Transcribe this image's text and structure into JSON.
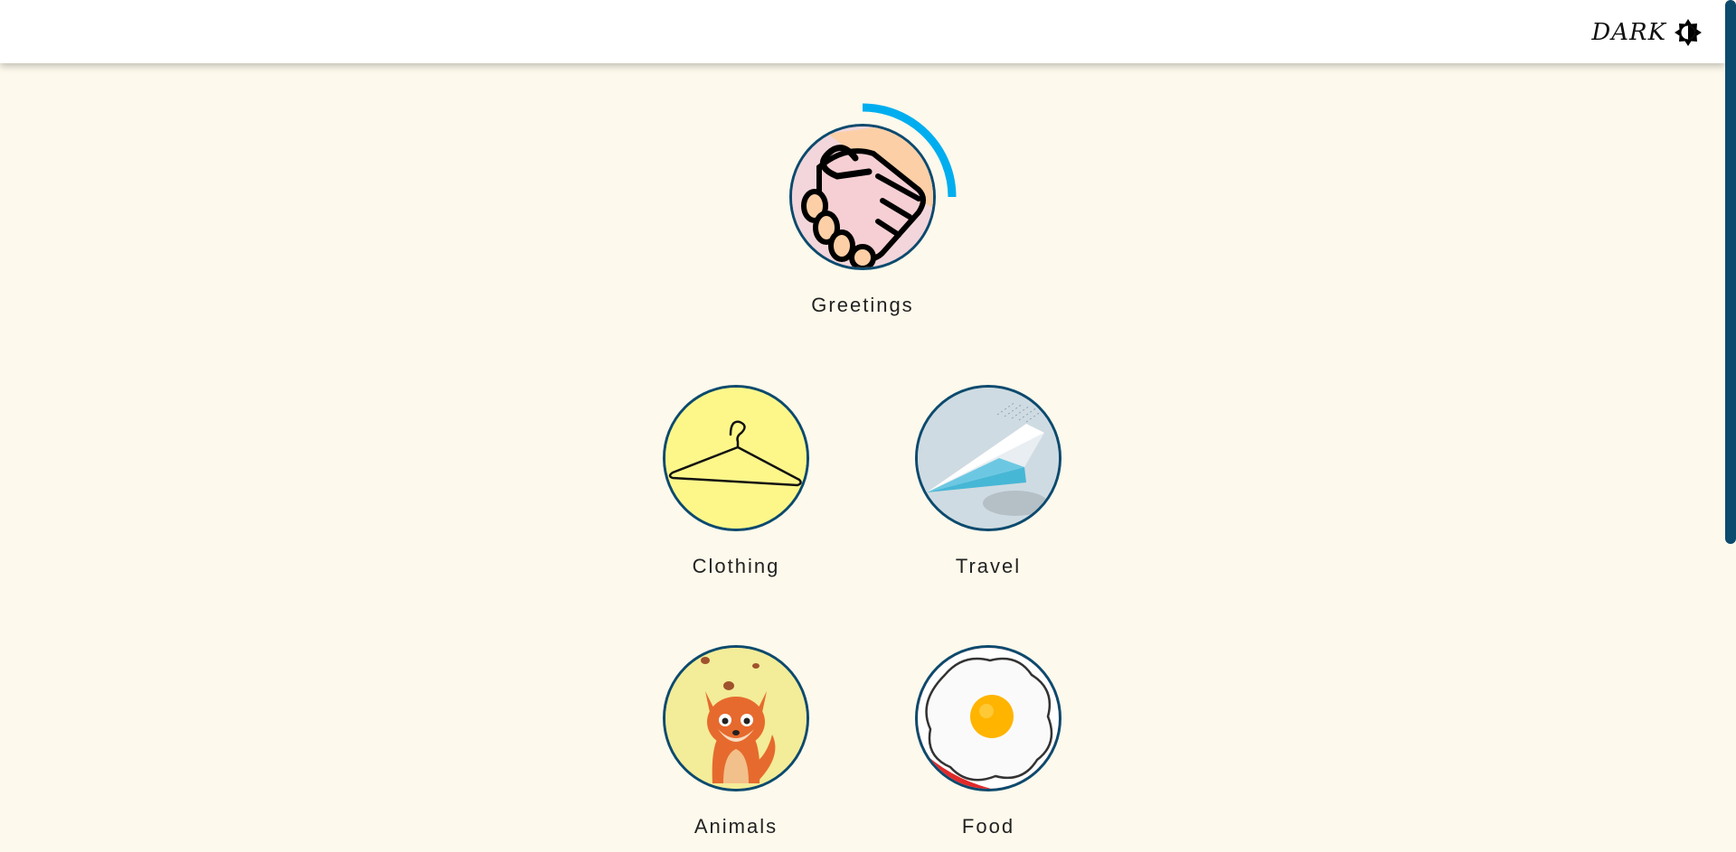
{
  "header": {
    "theme_label": "DARK",
    "theme_icon": "brightness-contrast-icon"
  },
  "units": [
    {
      "label": "Greetings",
      "icon": "handshake-icon",
      "progress": 0.25,
      "colors": {
        "bg": "#f2d6db"
      }
    },
    {
      "label": "Clothing",
      "icon": "hanger-icon",
      "colors": {
        "bg": "#fdf78a"
      }
    },
    {
      "label": "Travel",
      "icon": "paper-plane-icon",
      "colors": {
        "bg": "#cfdbe2"
      }
    },
    {
      "label": "Animals",
      "icon": "fox-icon",
      "colors": {
        "bg": "#f3ec98"
      }
    },
    {
      "label": "Food",
      "icon": "fried-egg-icon",
      "colors": {
        "bg": "#e02a2a"
      }
    }
  ],
  "colors": {
    "page_bg": "#fdf9ec",
    "accent": "#00aeef",
    "border": "#0c4a6e"
  }
}
